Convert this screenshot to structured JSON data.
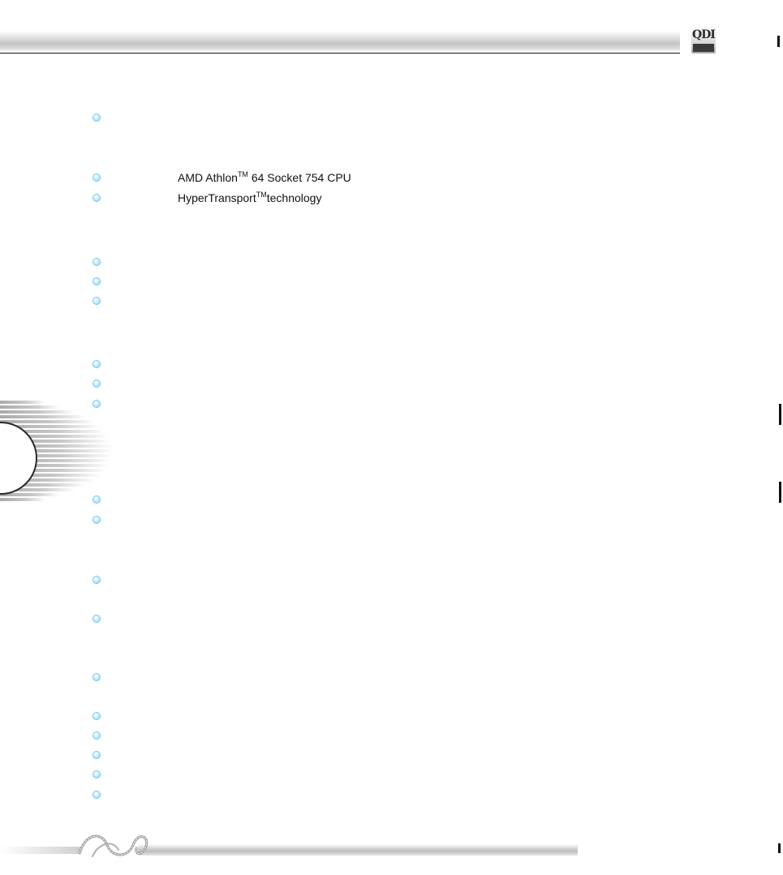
{
  "logo": {
    "letters": "QDI"
  },
  "features": [
    {
      "text": ""
    },
    {
      "text": "AMD Athlon",
      "sup": "TM",
      "suffix": " 64 Socket 754 CPU"
    },
    {
      "text": "HyperTransport",
      "sup": "TM",
      "suffix": "technology"
    },
    {
      "text": ""
    },
    {
      "text": ""
    },
    {
      "text": ""
    },
    {
      "text": ""
    },
    {
      "text": ""
    },
    {
      "text": ""
    },
    {
      "text": ""
    },
    {
      "text": ""
    },
    {
      "text": ""
    },
    {
      "text": ""
    },
    {
      "text": ""
    },
    {
      "text": ""
    },
    {
      "text": ""
    },
    {
      "text": ""
    },
    {
      "text": ""
    },
    {
      "text": ""
    }
  ]
}
